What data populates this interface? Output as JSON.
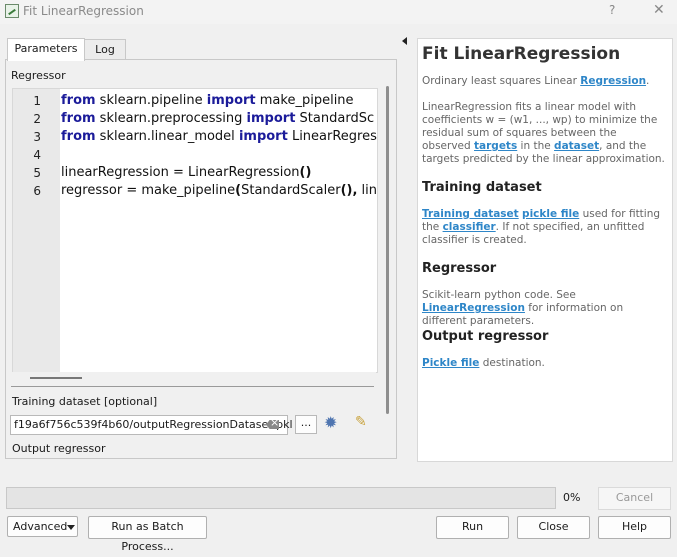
{
  "window": {
    "title": "Fit LinearRegression",
    "help_glyph": "?",
    "close_glyph": "✕"
  },
  "tabs": [
    {
      "label": "Parameters"
    },
    {
      "label": "Log"
    }
  ],
  "regressor": {
    "label": "Regressor",
    "line_numbers": [
      "1",
      "2",
      "3",
      "4",
      "5",
      "6"
    ]
  },
  "code_lines": [
    {
      "num": "1",
      "tokens": [
        {
          "t": "from",
          "k": "kw"
        },
        {
          "t": " sklearn.pipeline ",
          "k": ""
        },
        {
          "t": "import",
          "k": "kw"
        },
        {
          "t": " make_pipeline",
          "k": ""
        }
      ]
    },
    {
      "num": "2",
      "tokens": [
        {
          "t": "from",
          "k": "kw"
        },
        {
          "t": " sklearn.preprocessing ",
          "k": ""
        },
        {
          "t": "import",
          "k": "kw"
        },
        {
          "t": " StandardSc",
          "k": ""
        }
      ]
    },
    {
      "num": "3",
      "tokens": [
        {
          "t": "from",
          "k": "kw"
        },
        {
          "t": " sklearn.linear_model ",
          "k": ""
        },
        {
          "t": "import",
          "k": "kw"
        },
        {
          "t": " LinearRegres",
          "k": ""
        }
      ]
    },
    {
      "num": "4",
      "tokens": []
    },
    {
      "num": "5",
      "tokens": [
        {
          "t": "linearRegression = LinearRegression",
          "k": ""
        },
        {
          "t": "()",
          "k": "br"
        }
      ]
    },
    {
      "num": "6",
      "tokens": [
        {
          "t": "regressor = make_pipeline",
          "k": ""
        },
        {
          "t": "(",
          "k": "br"
        },
        {
          "t": "StandardScaler",
          "k": ""
        },
        {
          "t": "(),",
          "k": "br"
        },
        {
          "t": " lin",
          "k": ""
        }
      ]
    }
  ],
  "training": {
    "label": "Training dataset [optional]",
    "value": "f19a6f756c539f4b60/outputRegressionDataset.pkl",
    "browse_label": "..."
  },
  "output": {
    "label": "Output regressor"
  },
  "help": {
    "title": "Fit LinearRegression",
    "intro_text": "Ordinary least squares Linear ",
    "intro_link": "Regression",
    "intro_end": ".",
    "desc_1": "LinearRegression fits a linear model with coefficients w = (w1, ..., wp) to minimize the residual sum of squares between the observed ",
    "desc_link_1": "targets",
    "desc_2": " in the ",
    "desc_link_2": "dataset",
    "desc_3": ", and the targets predicted by the linear approximation.",
    "h_training": "Training dataset",
    "tr_link_1": "Training dataset",
    "tr_link_2": "pickle file",
    "tr_text_1": " used for fitting the ",
    "tr_link_3": "classifier",
    "tr_text_2": ". If not specified, an unfitted classifier is created.",
    "h_regressor": "Regressor",
    "rg_text": "Scikit-learn python code. See ",
    "rg_link": "LinearRegression",
    "rg_text_2": " for information on different parameters.",
    "h_output": "Output regressor",
    "out_link": "Pickle file",
    "out_text": " destination."
  },
  "progress": {
    "value_percent": 0,
    "text": "0%"
  },
  "buttons": {
    "cancel": "Cancel",
    "advanced": "Advanced",
    "batch": "Run as Batch Process...",
    "run": "Run",
    "close": "Close",
    "help": "Help"
  },
  "colors": {
    "link": "#2e86c8",
    "keyword": "#1b1b9a"
  }
}
